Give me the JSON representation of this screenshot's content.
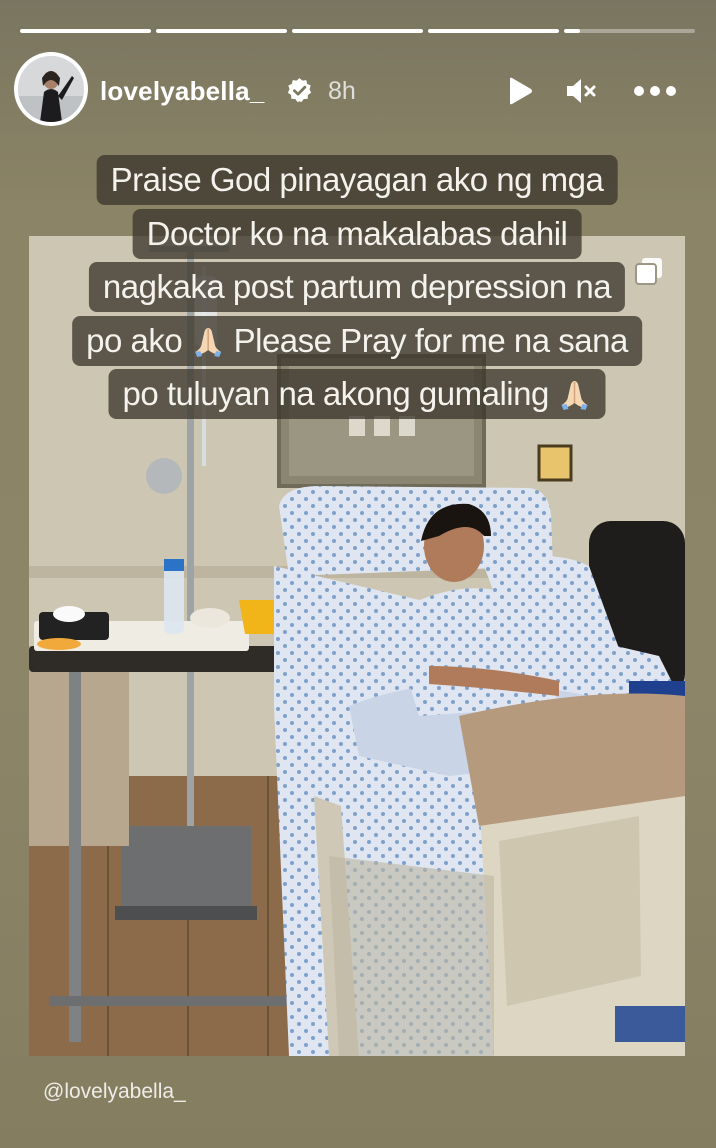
{
  "story": {
    "progress": [
      1,
      1,
      1,
      1,
      0.12
    ]
  },
  "header": {
    "username": "lovelyabella_",
    "verified_icon": "verified-badge-icon",
    "time": "8h",
    "controls": [
      "play-icon",
      "mute-icon",
      "more-icon"
    ]
  },
  "caption": {
    "lines": [
      "Praise God pinayagan ako ng mga",
      "Doctor ko na makalabas dahil",
      "nagkaka post partum depression na",
      "po ako",
      "Please Pray for me na sana",
      "po tuluyan na akong gumaling"
    ],
    "emoji": "folded-hands-emoji"
  },
  "credit": "@lovelyabella_",
  "colors": {
    "background": "#8b8466",
    "text": "#ffffff",
    "caption_bg": "#3c372d"
  }
}
